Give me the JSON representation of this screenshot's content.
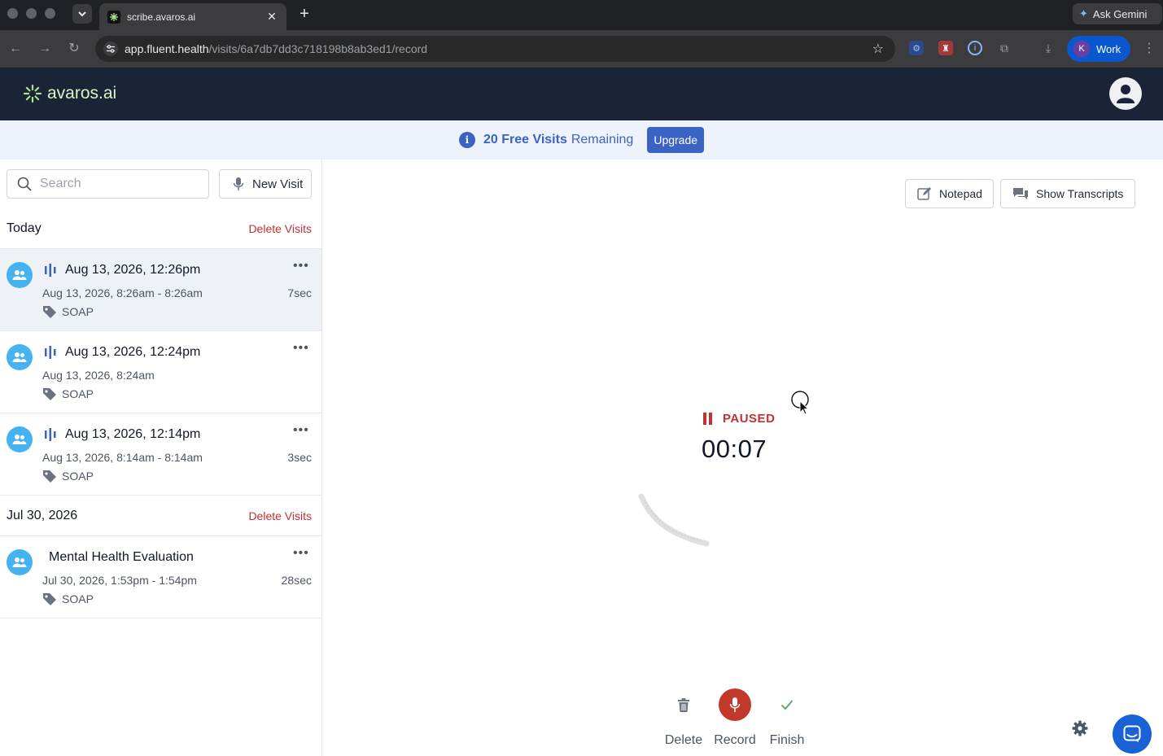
{
  "browser": {
    "tab_title": "scribe.avaros.ai",
    "url_host": "app.fluent.health",
    "url_path": "/visits/6a7db7dd3c718198b8ab3ed1/record",
    "gemini_label": "Ask Gemini",
    "profile_initial": "K",
    "profile_label": "Work"
  },
  "header": {
    "brand": "avaros.ai"
  },
  "banner": {
    "count_text": "20 Free Visits",
    "rest_text": "Remaining",
    "upgrade_label": "Upgrade"
  },
  "sidebar": {
    "search_placeholder": "Search",
    "new_visit_label": "New Visit",
    "groups": [
      {
        "title": "Today",
        "delete_label": "Delete Visits",
        "visits": [
          {
            "title": "Aug 13, 2026, 12:26pm",
            "range": "Aug 13, 2026, 8:26am - 8:26am",
            "duration": "7sec",
            "tag": "SOAP"
          },
          {
            "title": "Aug 13, 2026, 12:24pm",
            "range": "Aug 13, 2026, 8:24am",
            "duration": "",
            "tag": "SOAP"
          },
          {
            "title": "Aug 13, 2026, 12:14pm",
            "range": "Aug 13, 2026, 8:14am - 8:14am",
            "duration": "3sec",
            "tag": "SOAP"
          }
        ]
      },
      {
        "title": "Jul 30, 2026",
        "delete_label": "Delete Visits",
        "visits": [
          {
            "title": "Mental Health Evaluation",
            "range": "Jul 30, 2026, 1:53pm - 1:54pm",
            "duration": "28sec",
            "tag": "SOAP"
          }
        ]
      }
    ]
  },
  "main": {
    "notepad_label": "Notepad",
    "transcripts_label": "Show Transcripts",
    "status": "PAUSED",
    "timer": "00:07",
    "controls": {
      "delete_label": "Delete",
      "record_label": "Record",
      "finish_label": "Finish"
    }
  },
  "colors": {
    "header_bg": "#1b2436",
    "accent_blue": "#3b63c4",
    "danger_red": "#c53030",
    "avatar_blue": "#44b3f0",
    "finish_green": "#58a55c"
  }
}
